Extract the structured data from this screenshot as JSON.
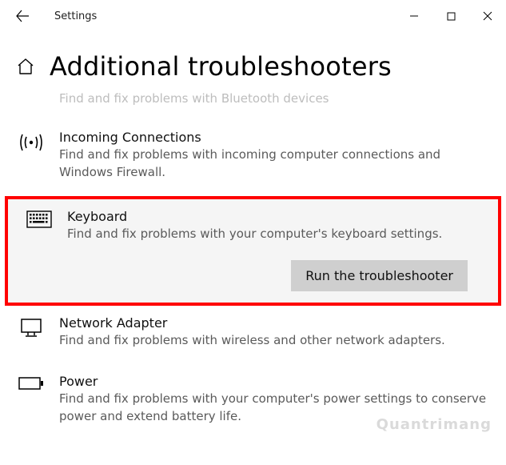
{
  "window": {
    "app_title": "Settings",
    "page_title": "Additional troubleshooters"
  },
  "truncated_top": {
    "desc": "Find and fix problems with Bluetooth devices"
  },
  "items": {
    "incoming": {
      "title": "Incoming Connections",
      "desc": "Find and fix problems with incoming computer connections and Windows Firewall."
    },
    "keyboard": {
      "title": "Keyboard",
      "desc": "Find and fix problems with your computer's keyboard settings.",
      "button": "Run the troubleshooter"
    },
    "network": {
      "title": "Network Adapter",
      "desc": "Find and fix problems with wireless and other network adapters."
    },
    "power": {
      "title": "Power",
      "desc": "Find and fix problems with your computer's power settings to conserve power and extend battery life."
    }
  },
  "watermark": "Quantrimang"
}
